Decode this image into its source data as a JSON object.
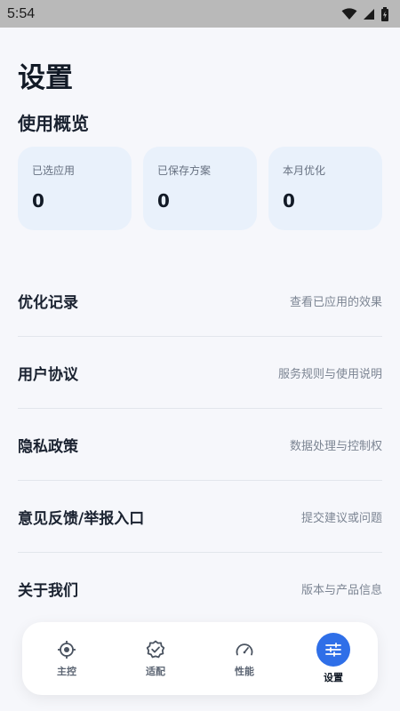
{
  "status_bar": {
    "time": "5:54"
  },
  "page": {
    "title": "设置"
  },
  "overview": {
    "title": "使用概览",
    "cards": [
      {
        "label": "已选应用",
        "value": "0"
      },
      {
        "label": "已保存方案",
        "value": "0"
      },
      {
        "label": "本月优化",
        "value": "0"
      }
    ]
  },
  "menu": [
    {
      "title": "优化记录",
      "desc": "查看已应用的效果"
    },
    {
      "title": "用户协议",
      "desc": "服务规则与使用说明"
    },
    {
      "title": "隐私政策",
      "desc": "数据处理与控制权"
    },
    {
      "title": "意见反馈/举报入口",
      "desc": "提交建议或问题"
    },
    {
      "title": "关于我们",
      "desc": "版本与产品信息"
    }
  ],
  "bottom_nav": {
    "items": [
      {
        "label": "主控",
        "icon": "target-icon"
      },
      {
        "label": "适配",
        "icon": "badge-check-icon"
      },
      {
        "label": "性能",
        "icon": "gauge-icon"
      },
      {
        "label": "设置",
        "icon": "sliders-icon"
      }
    ],
    "active_index": 3
  },
  "colors": {
    "accent": "#2f6fe8",
    "card_bg": "#e9f1fb",
    "page_bg": "#f6f7fb"
  }
}
